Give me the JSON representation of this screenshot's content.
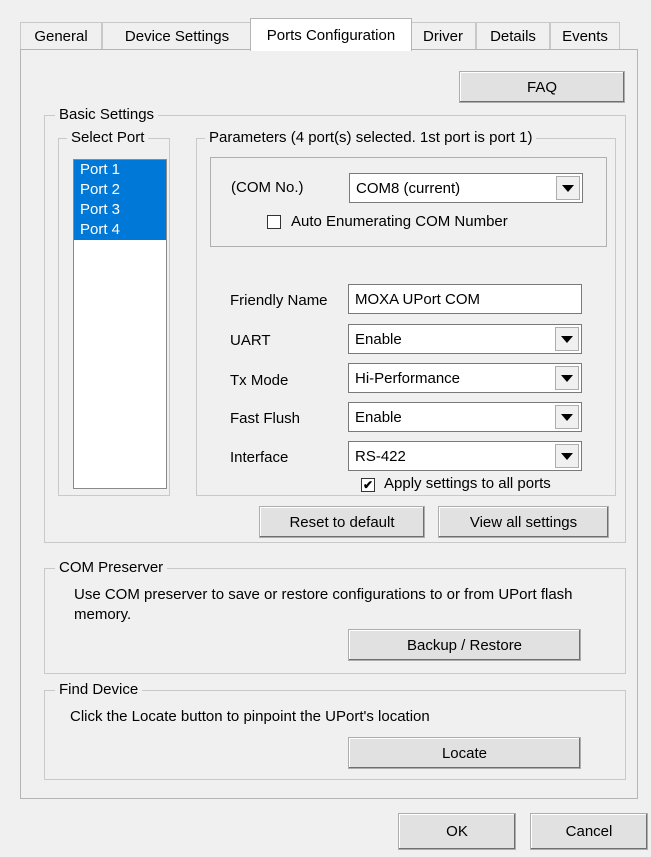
{
  "tabs": [
    "General",
    "Device Settings",
    "Ports Configuration",
    "Driver",
    "Details",
    "Events"
  ],
  "active_tab": "Ports Configuration",
  "faq_label": "FAQ",
  "basic_settings": {
    "title": "Basic Settings",
    "select_port_title": "Select Port",
    "ports": [
      "Port 1",
      "Port 2",
      "Port 3",
      "Port 4"
    ],
    "parameters_title": "Parameters (4 port(s) selected. 1st port is port 1)",
    "com_no_label": "(COM No.)",
    "com_no_value": "COM8 (current)",
    "auto_enum_label": "Auto Enumerating COM Number",
    "auto_enum_checked": false,
    "friendly_name_label": "Friendly Name",
    "friendly_name_value": "MOXA UPort COM",
    "uart_label": "UART",
    "uart_value": "Enable",
    "tx_mode_label": "Tx Mode",
    "tx_mode_value": "Hi-Performance",
    "fast_flush_label": "Fast Flush",
    "fast_flush_value": "Enable",
    "interface_label": "Interface",
    "interface_value": "RS-422",
    "apply_all_label": "Apply settings to all ports",
    "apply_all_checked": true,
    "reset_label": "Reset to default",
    "view_all_label": "View all settings"
  },
  "com_preserver": {
    "title": "COM Preserver",
    "description": "Use COM preserver to save or restore configurations to or from UPort flash memory.",
    "backup_label": "Backup / Restore"
  },
  "find_device": {
    "title": "Find Device",
    "description": "Click the Locate button to pinpoint the UPort's location",
    "locate_label": "Locate"
  },
  "footer": {
    "ok_label": "OK",
    "cancel_label": "Cancel"
  },
  "icons": {
    "dropdown": "chevron-down-icon",
    "checkmark": "checkmark-icon"
  }
}
